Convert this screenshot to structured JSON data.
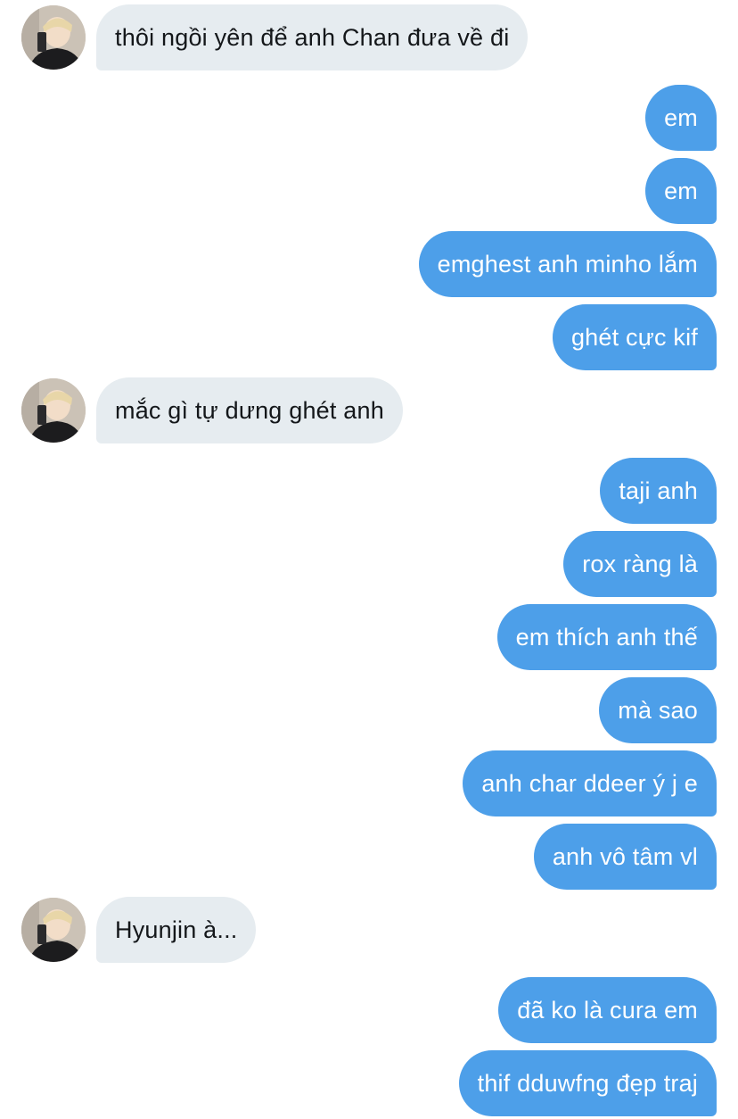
{
  "conversation": {
    "incoming": [
      {
        "text": "thôi ngồi yên để anh Chan đưa về đi"
      },
      {
        "text": "mắc gì tự dưng ghét anh"
      },
      {
        "text": "Hyunjin à..."
      }
    ],
    "outgoing": [
      {
        "text": "em"
      },
      {
        "text": "em"
      },
      {
        "text": "emghest anh minho lắm"
      },
      {
        "text": "ghét cực kif"
      },
      {
        "text": "taji anh "
      },
      {
        "text": "rox ràng là"
      },
      {
        "text": "em thích anh thế"
      },
      {
        "text": "mà sao"
      },
      {
        "text": "anh char ddeer ý j e"
      },
      {
        "text": "anh vô tâm vl"
      },
      {
        "text": "đã ko là cura em"
      },
      {
        "text": "thif dduwfng đẹp traj"
      }
    ]
  },
  "colors": {
    "outgoing_bubble": "#4d9fe9",
    "incoming_bubble": "#e6ecf0",
    "incoming_text": "#14171a",
    "outgoing_text": "#ffffff"
  },
  "icons": {
    "avatar": "contact-avatar"
  }
}
